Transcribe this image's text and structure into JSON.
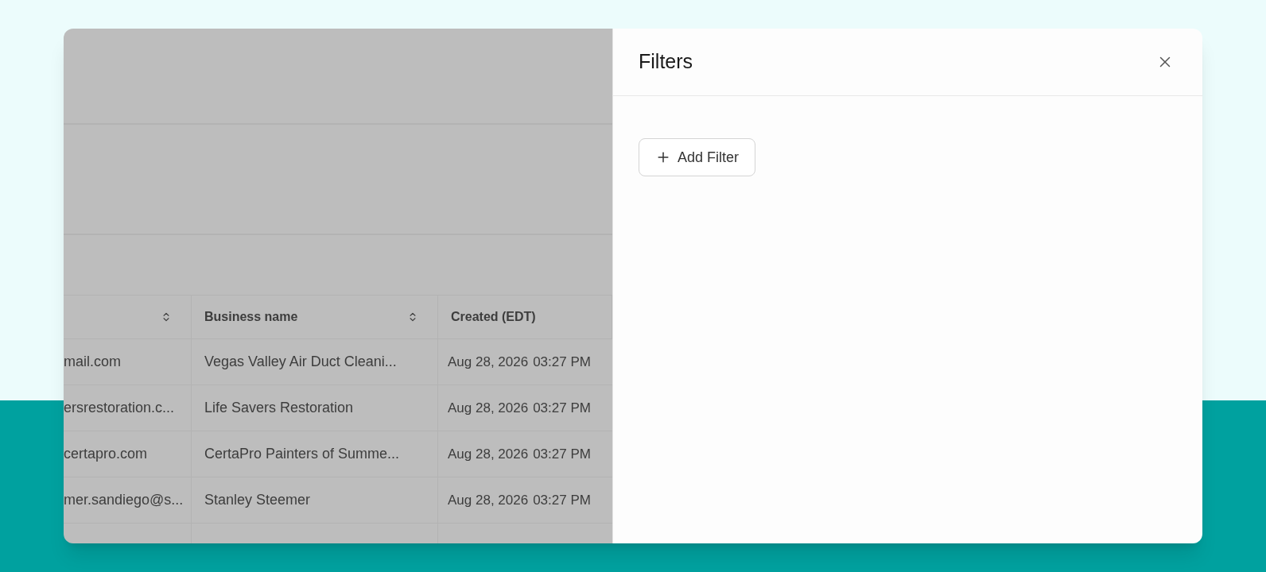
{
  "backdrop_table": {
    "columns": [
      {
        "sortable": true
      },
      {
        "label": "Business name",
        "sortable": true
      },
      {
        "label": "Created (EDT)",
        "sortable": false
      }
    ],
    "rows": [
      {
        "email": "mail.com",
        "business": "Vegas Valley Air Duct Cleani...",
        "date": "Aug 28, 2026",
        "time": "03:27 PM"
      },
      {
        "email": "ersrestoration.c...",
        "business": "Life Savers Restoration",
        "date": "Aug 28, 2026",
        "time": "03:27 PM"
      },
      {
        "email": "certapro.com",
        "business": "CertaPro Painters of Summe...",
        "date": "Aug 28, 2026",
        "time": "03:27 PM"
      },
      {
        "email": "mer.sandiego@s...",
        "business": "Stanley Steemer",
        "date": "Aug 28, 2026",
        "time": "03:27 PM"
      }
    ]
  },
  "filters_panel": {
    "title": "Filters",
    "add_button": "Add Filter"
  }
}
